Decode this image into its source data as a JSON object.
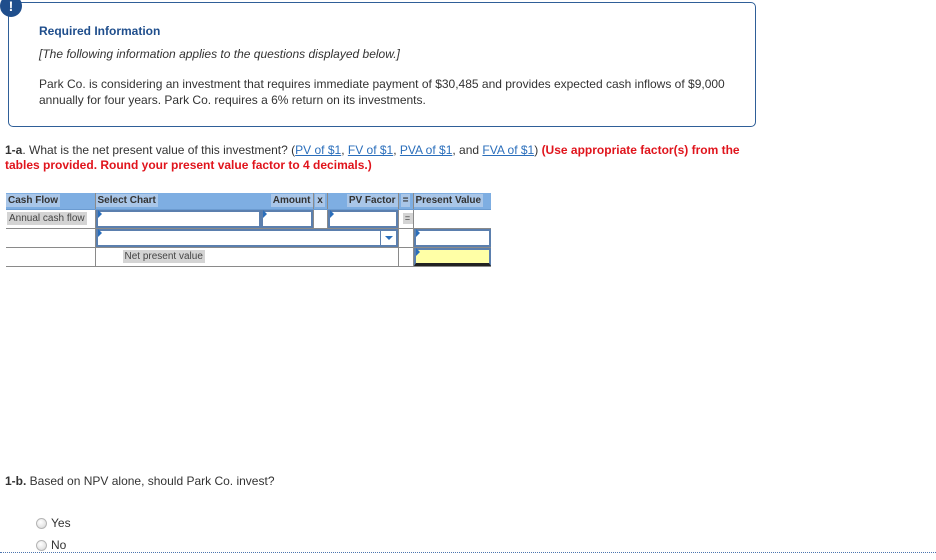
{
  "alert_icon": "exclamation-icon",
  "info": {
    "title": "Required Information",
    "note": "[The following information applies to the questions displayed below.]",
    "body": "Park Co. is considering an investment that requires immediate payment of $30,485 and provides expected cash inflows of $9,000 annually for four years. Park Co. requires a 6% return on its investments."
  },
  "question_1a": {
    "number": "1-a",
    "text": ". What is the net present value of this investment? (",
    "links": [
      "PV of $1",
      "FV of $1",
      "PVA of $1",
      "FVA of $1"
    ],
    "sep1": ", ",
    "sep_and": ", and ",
    "close": ") ",
    "instruction": "(Use appropriate factor(s) from the tables provided. Round your present value factor to 4 decimals.)"
  },
  "table": {
    "headers": {
      "cash_flow": "Cash Flow",
      "select_chart": "Select Chart",
      "amount": "Amount",
      "x": "x",
      "pv_factor": "PV Factor",
      "eq": "=",
      "present_value": "Present Value"
    },
    "rows": [
      {
        "cash_flow": "Annual cash flow",
        "select_chart": "",
        "amount": "",
        "pv_factor": "",
        "eq": "=",
        "present_value": ""
      },
      {
        "cash_flow": "",
        "select_chart_dropdown": "",
        "present_value": ""
      },
      {
        "label": "Net present value",
        "present_value": ""
      }
    ]
  },
  "question_1b": {
    "number": "1-b.",
    "text": " Based on NPV alone, should Park Co. invest?",
    "options": [
      "Yes",
      "No"
    ]
  },
  "colors": {
    "accent_blue": "#1f4e8c",
    "link_blue": "#2a6ebb",
    "warning_red": "#e0141c",
    "header_blue": "#7eaee2",
    "highlight_yellow": "#ffffa6"
  }
}
